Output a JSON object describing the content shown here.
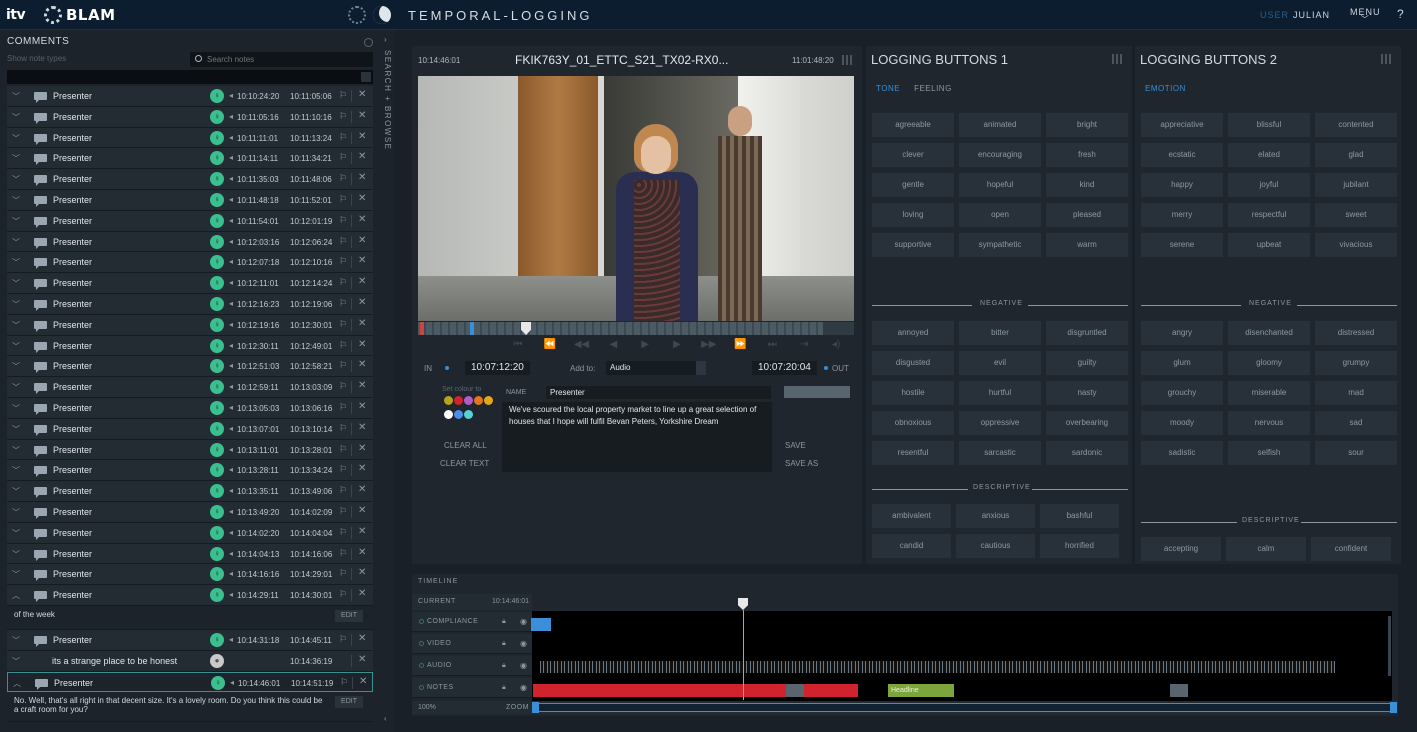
{
  "topbar": {
    "itv": "itv",
    "blam": "BLAM",
    "app_title": "TEMPORAL-LOGGING",
    "user_label": "USER",
    "user_name": "JULIAN",
    "menu_label": "MENU",
    "help_label": "?"
  },
  "comments": {
    "title": "COMMENTS",
    "show_note_types": "Show note types",
    "search_placeholder": "Search notes",
    "side_label": "SEARCH + BROWSE",
    "rows_before": [
      {
        "name": "Presenter",
        "t1": "10:10:24:20",
        "t2": "10:11:05:06"
      },
      {
        "name": "Presenter",
        "t1": "10:11:05:16",
        "t2": "10:11:10:16"
      },
      {
        "name": "Presenter",
        "t1": "10:11:11:01",
        "t2": "10:11:13:24"
      },
      {
        "name": "Presenter",
        "t1": "10:11:14:11",
        "t2": "10:11:34:21"
      },
      {
        "name": "Presenter",
        "t1": "10:11:35:03",
        "t2": "10:11:48:06"
      },
      {
        "name": "Presenter",
        "t1": "10:11:48:18",
        "t2": "10:11:52:01"
      },
      {
        "name": "Presenter",
        "t1": "10:11:54:01",
        "t2": "10:12:01:19"
      },
      {
        "name": "Presenter",
        "t1": "10:12:03:16",
        "t2": "10:12:06:24"
      },
      {
        "name": "Presenter",
        "t1": "10:12:07:18",
        "t2": "10:12:10:16"
      },
      {
        "name": "Presenter",
        "t1": "10:12:11:01",
        "t2": "10:12:14:24"
      },
      {
        "name": "Presenter",
        "t1": "10:12:16:23",
        "t2": "10:12:19:06"
      },
      {
        "name": "Presenter",
        "t1": "10:12:19:16",
        "t2": "10:12:30:01"
      },
      {
        "name": "Presenter",
        "t1": "10:12:30:11",
        "t2": "10:12:49:01"
      },
      {
        "name": "Presenter",
        "t1": "10:12:51:03",
        "t2": "10:12:58:21"
      },
      {
        "name": "Presenter",
        "t1": "10:12:59:11",
        "t2": "10:13:03:09"
      },
      {
        "name": "Presenter",
        "t1": "10:13:05:03",
        "t2": "10:13:06:16"
      },
      {
        "name": "Presenter",
        "t1": "10:13:07:01",
        "t2": "10:13:10:14"
      },
      {
        "name": "Presenter",
        "t1": "10:13:11:01",
        "t2": "10:13:28:01"
      },
      {
        "name": "Presenter",
        "t1": "10:13:28:11",
        "t2": "10:13:34:24"
      },
      {
        "name": "Presenter",
        "t1": "10:13:35:11",
        "t2": "10:13:49:06"
      },
      {
        "name": "Presenter",
        "t1": "10:13:49:20",
        "t2": "10:14:02:09"
      },
      {
        "name": "Presenter",
        "t1": "10:14:02:20",
        "t2": "10:14:04:04"
      },
      {
        "name": "Presenter",
        "t1": "10:14:04:13",
        "t2": "10:14:16:06"
      },
      {
        "name": "Presenter",
        "t1": "10:14:16:16",
        "t2": "10:14:29:01"
      },
      {
        "name": "Presenter",
        "t1": "10:14:29:11",
        "t2": "10:14:30:01"
      }
    ],
    "expanded_text": "of the week",
    "edit_label": "EDIT",
    "row_after": {
      "name": "Presenter",
      "t1": "10:14:31:18",
      "t2": "10:14:45:11"
    },
    "sub_note": {
      "name": "its a strange place to be honest",
      "t2": "10:14:36:19"
    },
    "row_selected": {
      "name": "Presenter",
      "t1": "10:14:46:01",
      "t2": "10:14:51:19"
    },
    "selected_text": "No. Well, that's all right in that decent size. It's a lovely room. Do you think this could be a craft room for you?"
  },
  "video": {
    "tc_in": "10:14:46:01",
    "clip_title": "FKIK763Y_01_ETTC_S21_TX02-RX0...",
    "tc_out": "11:01:48:20",
    "in_label": "IN",
    "in_value": "10:07:12:20",
    "add_to_label": "Add to:",
    "add_to_value": "Audio",
    "out_value": "10:07:20:04",
    "out_label": "OUT",
    "set_colour": "Set colour to",
    "clear_all": "CLEAR ALL",
    "clear_text": "CLEAR TEXT",
    "name_label": "NAME",
    "name_value": "Presenter",
    "note_text": "We've scoured the local property market to line up a great selection of houses that I hope will fulfil Bevan Peters, Yorkshire Dream",
    "save": "SAVE",
    "save_as": "SAVE AS",
    "swatches": [
      "#b7a21d",
      "#d1232e",
      "#b05ccf",
      "#e2761c",
      "#e2a81c",
      "#ffffff",
      "#4a8fe8",
      "#58d0d8"
    ]
  },
  "log1": {
    "title": "LOGGING BUTTONS 1",
    "tabs": [
      "TONE",
      "FEELING"
    ],
    "positive": [
      "agreeable",
      "animated",
      "bright",
      "clever",
      "encouraging",
      "fresh",
      "gentle",
      "hopeful",
      "kind",
      "loving",
      "open",
      "pleased",
      "supportive",
      "sympathetic",
      "warm"
    ],
    "negative_label": "NEGATIVE",
    "negative": [
      "annoyed",
      "bitter",
      "disgruntled",
      "disgusted",
      "evil",
      "guilty",
      "hostile",
      "hurtful",
      "nasty",
      "obnoxious",
      "oppressive",
      "overbearing",
      "resentful",
      "sarcastic",
      "sardonic"
    ],
    "descriptive_label": "DESCRIPTIVE",
    "descriptive": [
      "ambivalent",
      "anxious",
      "bashful",
      "candid",
      "cautious",
      "horrified"
    ]
  },
  "log2": {
    "title": "LOGGING BUTTONS 2",
    "tabs": [
      "EMOTION"
    ],
    "positive": [
      "appreciative",
      "blissful",
      "contented",
      "ecstatic",
      "elated",
      "glad",
      "happy",
      "joyful",
      "jubilant",
      "merry",
      "respectful",
      "sweet",
      "serene",
      "upbeat",
      "vivacious"
    ],
    "negative_label": "NEGATIVE",
    "negative": [
      "angry",
      "disenchanted",
      "distressed",
      "glum",
      "gloomy",
      "grumpy",
      "grouchy",
      "miserable",
      "mad",
      "moody",
      "nervous",
      "sad",
      "sadistic",
      "selfish",
      "sour"
    ],
    "descriptive_label": "DESCRIPTIVE",
    "descriptive": [
      "accepting",
      "calm",
      "confident"
    ]
  },
  "timeline": {
    "title": "TIMELINE",
    "current_label": "CURRENT",
    "current_value": "10:14:46:01",
    "tracks": [
      "COMPLIANCE",
      "VIDEO",
      "AUDIO",
      "NOTES"
    ],
    "headline_label": "Headline",
    "zoom_pct": "100%",
    "zoom_label": "ZOOM"
  }
}
